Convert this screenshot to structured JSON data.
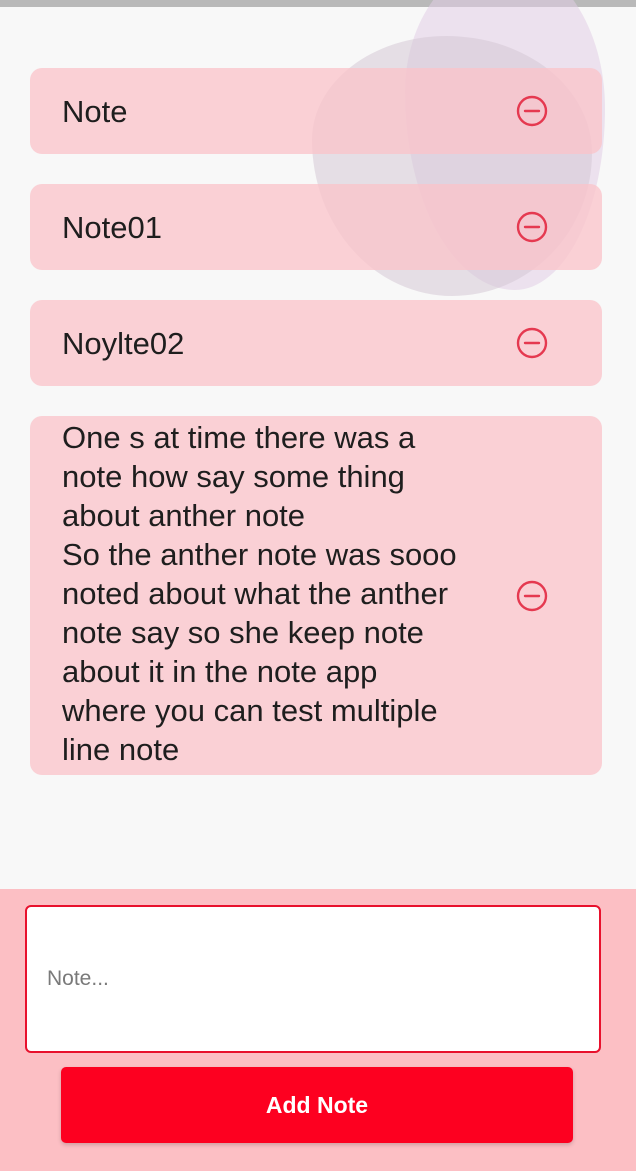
{
  "notes": [
    {
      "text": "Note",
      "remove_icon": "minus-circle-icon"
    },
    {
      "text": "Note01",
      "remove_icon": "minus-circle-icon"
    },
    {
      "text": "Noylte02",
      "remove_icon": "minus-circle-icon"
    },
    {
      "text": "One s at time there was a\nnote how say some thing\nabout anther note\nSo the anther note was sooo\nnoted about what the anther\nnote say so she keep  note\nabout it in the note app\nwhere you can test multiple\nline note",
      "remove_icon": "minus-circle-icon"
    }
  ],
  "composer": {
    "placeholder": "Note...",
    "value": "",
    "add_button_label": "Add Note"
  },
  "colors": {
    "card_background": "#fac4ca",
    "remove_icon": "#e53950",
    "panel_background": "#fcbfc4",
    "input_border": "#e8112d",
    "button_background": "#fd0020",
    "button_text": "#ffffff"
  }
}
